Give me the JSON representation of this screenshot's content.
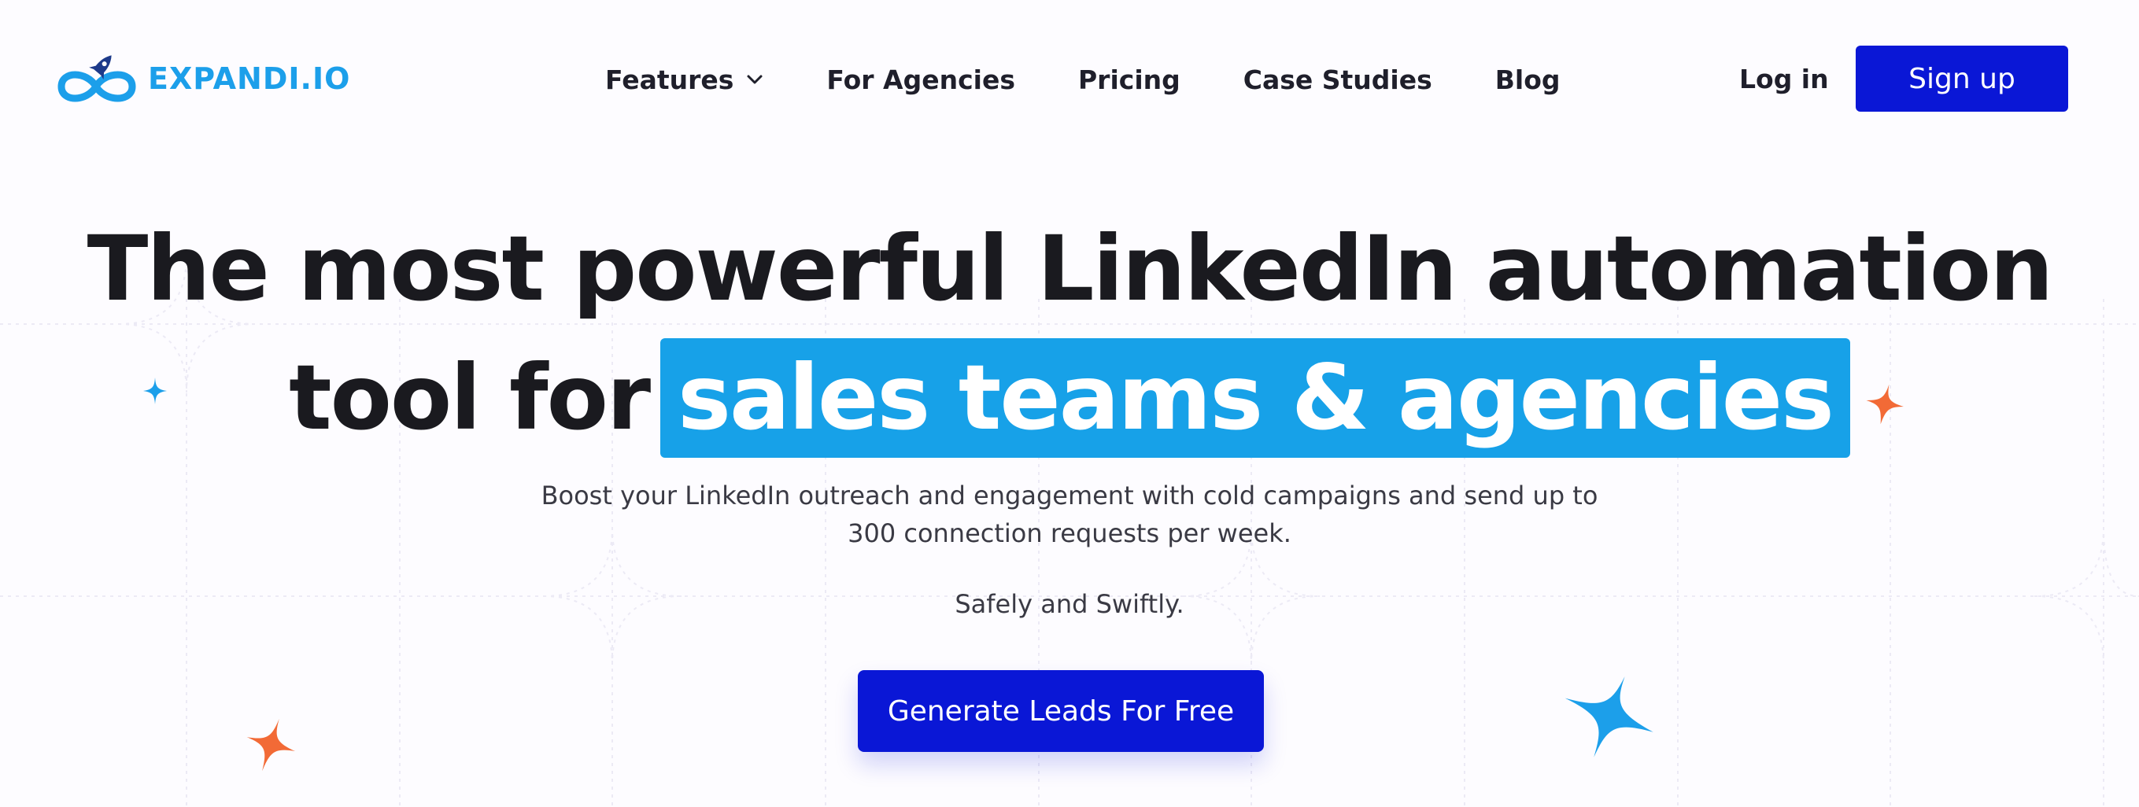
{
  "brand": {
    "name": "EXPANDI.IO",
    "color": "#1c9fea"
  },
  "nav": {
    "items": [
      {
        "label": "Features",
        "has_dropdown": true,
        "icon": "chevron-down-icon"
      },
      {
        "label": "For Agencies"
      },
      {
        "label": "Pricing"
      },
      {
        "label": "Case Studies"
      },
      {
        "label": "Blog"
      }
    ],
    "login_label": "Log in",
    "signup_label": "Sign up"
  },
  "hero": {
    "headline_line1": "The most powerful LinkedIn automation",
    "headline_line2_prefix": "tool for",
    "headline_highlight": "sales teams & agencies",
    "subtitle_line1": "Boost your LinkedIn outreach and engagement with cold campaigns and send up to",
    "subtitle_line2": "300 connection requests per week.",
    "tagline": "Safely and Swiftly.",
    "cta_label": "Generate Leads For Free"
  },
  "colors": {
    "primary_button": "#0a17d6",
    "highlight": "#17a1e8",
    "sparkle_orange": "#f26a36",
    "sparkle_blue": "#1c9fea",
    "heading_text": "#1a1a1f"
  },
  "decorations": {
    "sparkles": [
      "sparkle-icon-blue",
      "sparkle-icon-orange"
    ]
  }
}
